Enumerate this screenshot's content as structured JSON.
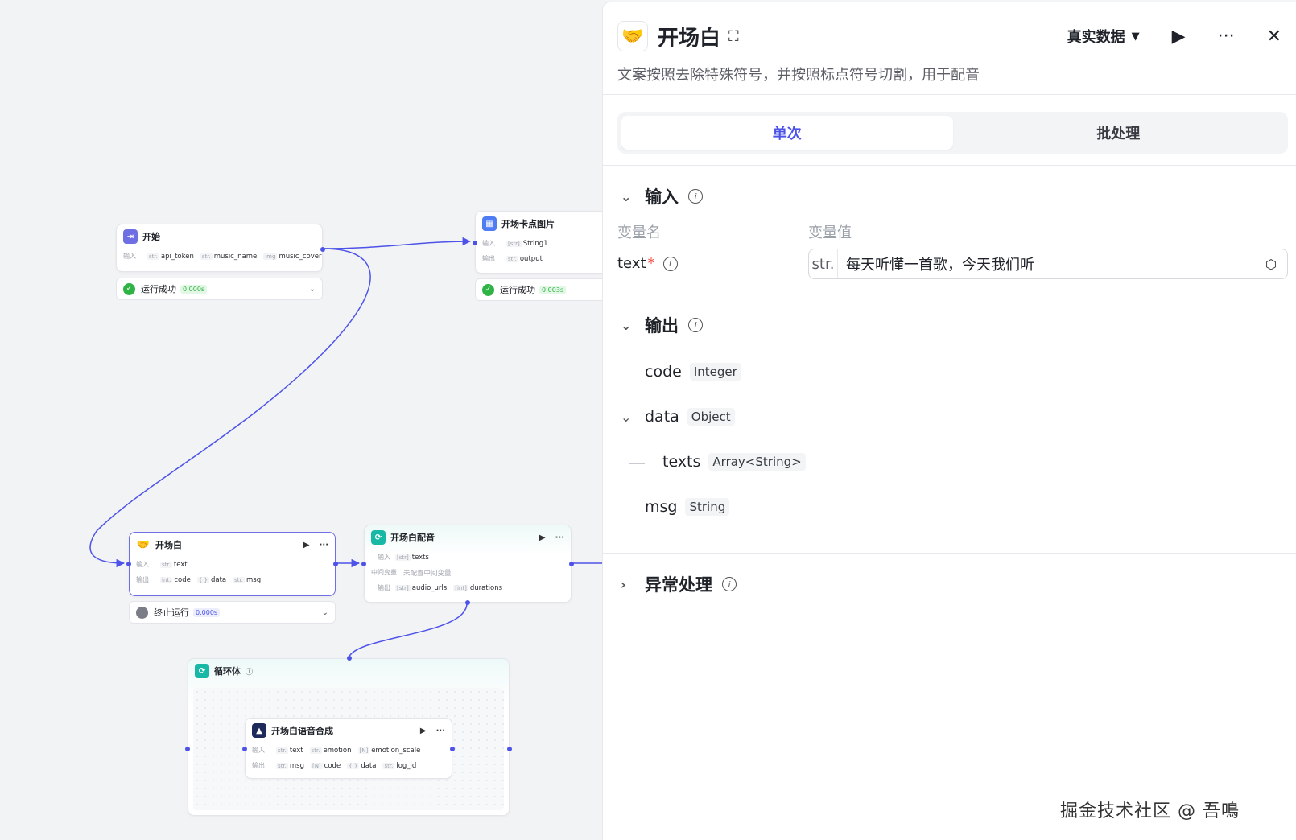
{
  "canvas": {
    "start_node": {
      "title": "开始",
      "input_label": "输入",
      "inputs": [
        {
          "type": "str.",
          "name": "api_token"
        },
        {
          "type": "str.",
          "name": "music_name"
        },
        {
          "type": "img",
          "name": "music_cover"
        }
      ],
      "status": {
        "label": "运行成功",
        "time": "0.000s"
      }
    },
    "image_node": {
      "title": "开场卡点图片",
      "input_label": "输入",
      "output_label": "输出",
      "inputs": [
        {
          "type": "[str]",
          "name": "String1"
        }
      ],
      "outputs": [
        {
          "type": "str.",
          "name": "output"
        }
      ],
      "status": {
        "label": "运行成功",
        "time": "0.003s"
      }
    },
    "opening_node": {
      "title": "开场白",
      "input_label": "输入",
      "output_label": "输出",
      "inputs": [
        {
          "type": "str.",
          "name": "text"
        }
      ],
      "outputs": [
        {
          "type": "int.",
          "name": "code"
        },
        {
          "type": "{ }",
          "name": "data"
        },
        {
          "type": "str.",
          "name": "msg"
        }
      ],
      "status": {
        "label": "终止运行",
        "time": "0.000s"
      }
    },
    "dubbing_node": {
      "title": "开场白配音",
      "input_label": "输入",
      "middle_label": "中间变量",
      "output_label": "输出",
      "inputs": [
        {
          "type": "[str]",
          "name": "texts"
        }
      ],
      "middle_value": "未配置中间变量",
      "outputs": [
        {
          "type": "[str]",
          "name": "audio_urls"
        },
        {
          "type": "[int]",
          "name": "durations"
        }
      ]
    },
    "loop_node": {
      "title": "循环体"
    },
    "tts_node": {
      "title": "开场白语音合成",
      "input_label": "输入",
      "output_label": "输出",
      "inputs": [
        {
          "type": "str.",
          "name": "text"
        },
        {
          "type": "str.",
          "name": "emotion"
        },
        {
          "type": "[N]",
          "name": "emotion_scale"
        }
      ],
      "outputs": [
        {
          "type": "str.",
          "name": "msg"
        },
        {
          "type": "[N]",
          "name": "code"
        },
        {
          "type": "{ }",
          "name": "data"
        },
        {
          "type": "str.",
          "name": "log_id"
        }
      ]
    }
  },
  "panel": {
    "title": "开场白",
    "description": "文案按照去除特殊符号，并按照标点符号切割，用于配音",
    "mode": "真实数据",
    "tabs": [
      "单次",
      "批处理"
    ],
    "input_section": {
      "title": "输入",
      "col_name": "变量名",
      "col_value": "变量值",
      "var_name": "text",
      "required_mark": "*",
      "value_type": "str.",
      "value": "每天听懂一首歌，今天我们听"
    },
    "output_section": {
      "title": "输出",
      "fields": [
        {
          "name": "code",
          "type": "Integer"
        },
        {
          "name": "data",
          "type": "Object"
        },
        {
          "name": "texts",
          "type": "Array<String>"
        },
        {
          "name": "msg",
          "type": "String"
        }
      ]
    },
    "error_section": {
      "title": "异常处理"
    }
  },
  "watermark": "掘金技术社区 @ 吾鳴",
  "colors": {
    "accent": "#4d53e8",
    "success": "#2fb344",
    "stopped": "#7a7d85"
  }
}
